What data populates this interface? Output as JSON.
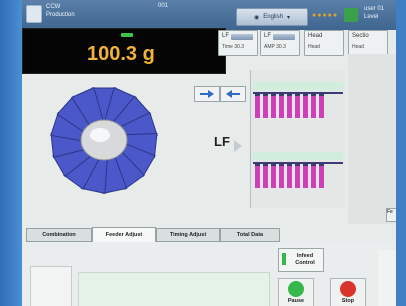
{
  "header": {
    "app_line1": "CCW",
    "app_line2": "Production",
    "count": "001",
    "language": "English",
    "user_line1": "user 01",
    "user_line2": "Level"
  },
  "weight": {
    "value": "100.3 g"
  },
  "columns": [
    {
      "label": "LF",
      "sub": "Time 30.3"
    },
    {
      "label": "LF",
      "sub": "AMP 30.3"
    },
    {
      "label": "Head",
      "sub": "Head"
    },
    {
      "label": "Sectio",
      "sub": "Head"
    }
  ],
  "controls": {
    "lf_label": "LF",
    "feeder_tag": "Fe"
  },
  "tabs": [
    {
      "label": "Combination",
      "active": false
    },
    {
      "label": "Feeder Adjust",
      "active": true
    },
    {
      "label": "Timing Adjust",
      "active": false
    },
    {
      "label": "Total Data",
      "active": false
    }
  ],
  "buttons": {
    "infeed": "Infeed Control",
    "pause": "Pause",
    "stop": "Stop"
  },
  "colors": {
    "accent_blue": "#3f7fc3",
    "weight_digits": "#f2b23c",
    "feeder_bar": "#cf3fb9",
    "go_green": "#37b84a",
    "stop_red": "#d9342b"
  }
}
